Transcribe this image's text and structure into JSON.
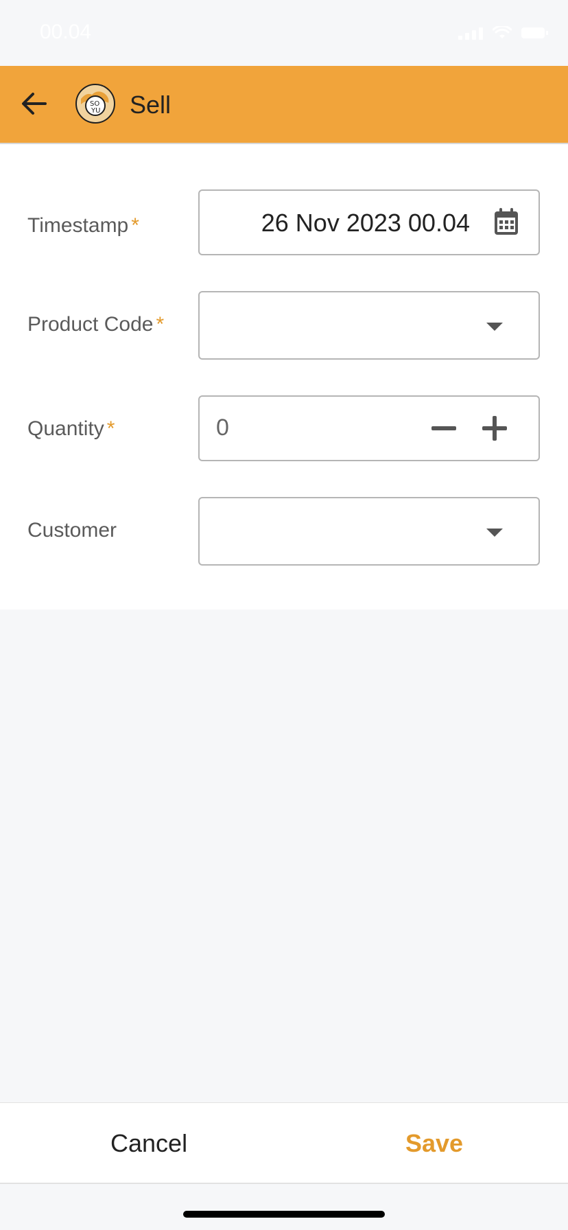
{
  "status_bar": {
    "time": "00.04"
  },
  "appbar": {
    "title": "Sell",
    "back_icon": "arrow-left-icon",
    "logo_icon": "app-logo",
    "bg_color": "#f1a43b"
  },
  "form": {
    "timestamp": {
      "label": "Timestamp",
      "required_mark": "*",
      "value": "26 Nov 2023 00.04",
      "icon": "calendar-icon"
    },
    "product_code": {
      "label": "Product Code",
      "required_mark": "*",
      "value": "",
      "icon": "caret-down-icon"
    },
    "quantity": {
      "label": "Quantity",
      "required_mark": "*",
      "value": "0",
      "minus_icon": "minus-icon",
      "plus_icon": "plus-icon"
    },
    "customer": {
      "label": "Customer",
      "value": "",
      "icon": "caret-down-icon"
    }
  },
  "footer": {
    "cancel_label": "Cancel",
    "save_label": "Save",
    "accent_color": "#e39a2c"
  }
}
